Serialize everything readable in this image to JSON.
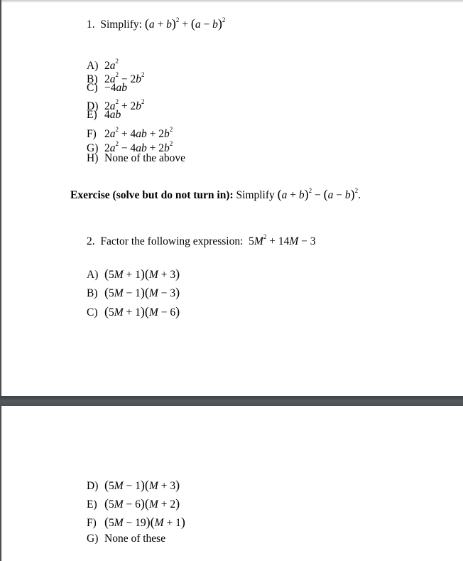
{
  "page1": {
    "question1": {
      "number": "1.",
      "prompt": "Simplify:",
      "expression": {
        "lparen": "(",
        "a": "a",
        "plus": " + ",
        "b": "b",
        "rparen": ")",
        "exp": "2",
        "join": " + ",
        "minus": " − "
      },
      "options": [
        {
          "label": "A)",
          "parts": [
            "2",
            "a",
            "2"
          ]
        },
        {
          "label": "B)",
          "text": "2a² − 2b²"
        },
        {
          "label": "C)",
          "text": "−4ab"
        },
        {
          "label": "D)",
          "text": "2a² + 2b²"
        },
        {
          "label": "E)",
          "text": "4ab"
        },
        {
          "label": "F)",
          "text": "2a² + 4ab + 2b²"
        },
        {
          "label": "G)",
          "text": "2a² − 4ab + 2b²"
        },
        {
          "label": "H)",
          "text": "None of the above"
        }
      ]
    },
    "exercise": {
      "bold_label": "Exercise (solve but do not turn in):",
      "prompt": "Simplify",
      "expression": "(a + b)² − (a − b)²",
      "end": "."
    },
    "question2": {
      "number": "2.",
      "prompt": "Factor the following expression:",
      "expression": "5M² + 14M − 3",
      "options": [
        {
          "label": "A)",
          "text": "(5M + 1)(M + 3)"
        },
        {
          "label": "B)",
          "text": "(5M − 1)(M − 3)"
        },
        {
          "label": "C)",
          "text": "(5M + 1)(M − 6)"
        }
      ]
    }
  },
  "page2": {
    "question2_continued": {
      "options": [
        {
          "label": "D)",
          "text": "(5M − 1)(M + 3)"
        },
        {
          "label": "E)",
          "text": "(5M − 6)(M + 2)"
        },
        {
          "label": "F)",
          "text": "(5M − 19)(M + 1)"
        },
        {
          "label": "G)",
          "text": "None of these"
        }
      ]
    }
  }
}
